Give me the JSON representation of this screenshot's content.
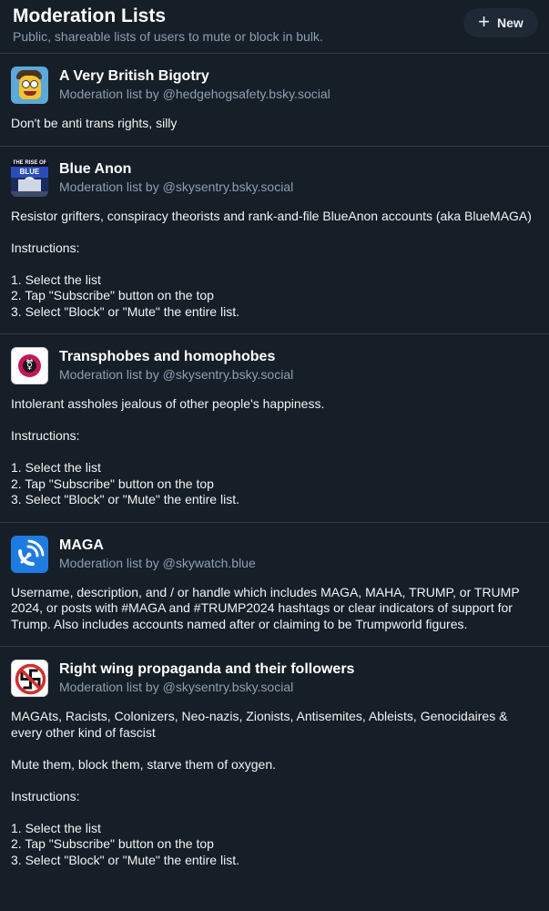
{
  "header": {
    "title": "Moderation Lists",
    "subtitle": "Public, shareable lists of users to mute or block in bulk.",
    "new_button_label": "New",
    "new_button_icon": "plus-icon"
  },
  "colors": {
    "background": "#161e27",
    "divider": "#2e3b47",
    "muted_text": "#8d9fb3",
    "button_bg": "#1e2935"
  },
  "lists": [
    {
      "name": "A Very British Bigotry",
      "byline": "Moderation list by @hedgehogsafety.bsky.social",
      "description": "Don't be anti trans rights, silly",
      "avatar": "cartoon-character-avatar"
    },
    {
      "name": "Blue Anon",
      "byline": "Moderation list by @skysentry.bsky.social",
      "description": "Resistor grifters, conspiracy theorists and rank-and-file BlueAnon accounts (aka BlueMAGA)\n\nInstructions:\n\n1. Select the list\n2. Tap \"Subscribe\" button on the top\n3. Select \"Block\" or \"Mute\" the entire list.",
      "avatar": "blue-anon-poster-avatar",
      "avatar_text_top": "THE RISE OF",
      "avatar_text_band": "BLUE ANON"
    },
    {
      "name": "Transphobes and homophobes",
      "byline": "Moderation list by @skysentry.bsky.social",
      "description": "Intolerant assholes jealous of other people's happiness.\n\nInstructions:\n\n1. Select the list\n2. Tap \"Subscribe\" button on the top\n3. Select \"Block\" or \"Mute\" the entire list.",
      "avatar": "transgender-symbol-avatar"
    },
    {
      "name": "MAGA",
      "byline": "Moderation list by @skywatch.blue",
      "description": "Username, description, and / or handle which includes MAGA, MAHA, TRUMP, or TRUMP 2024, or posts with #MAGA and #TRUMP2024 hashtags or clear indicators of support for Trump. Also includes accounts named after or claiming to be Trumpworld figures.",
      "avatar": "satellite-dish-avatar"
    },
    {
      "name": "Right wing propaganda and their followers",
      "byline": "Moderation list by @skysentry.bsky.social",
      "description": "MAGAts, Racists, Colonizers, Neo-nazis, Zionists, Antisemites, Ableists, Genocidaires & every other kind of fascist\n\nMute them, block them, starve them of oxygen.\n\nInstructions:\n\n1. Select the list\n2. Tap \"Subscribe\" button on the top\n3. Select \"Block\" or \"Mute\" the entire list.",
      "avatar": "no-swastika-avatar"
    }
  ]
}
